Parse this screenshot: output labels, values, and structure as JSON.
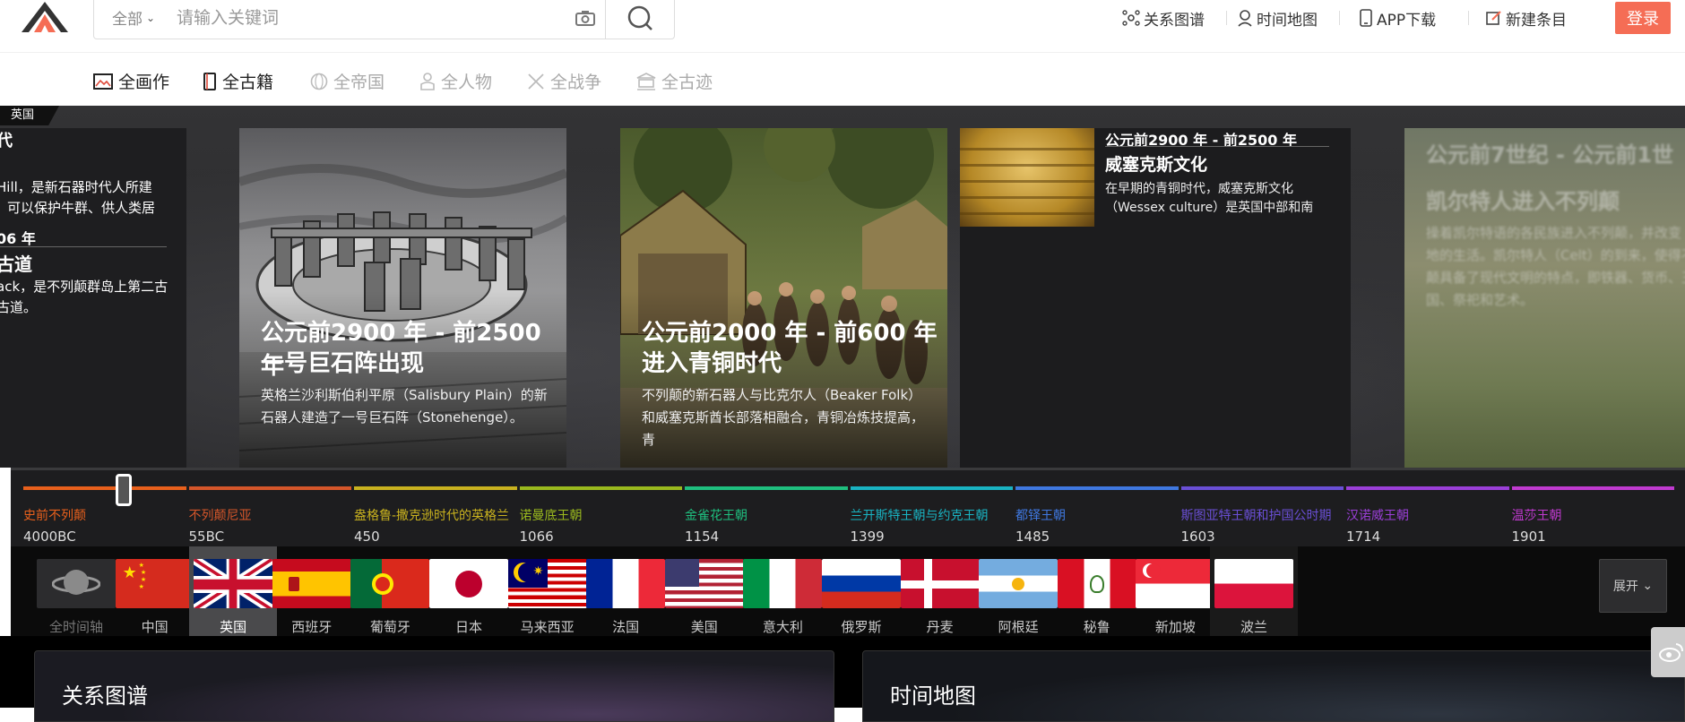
{
  "header": {
    "search": {
      "scope": "全部",
      "placeholder": "请输入关键词"
    },
    "nav": [
      {
        "label": "关系图谱",
        "icon": "relation-graph-icon"
      },
      {
        "label": "时间地图",
        "icon": "map-pin-icon"
      },
      {
        "label": "APP下载",
        "icon": "phone-icon"
      },
      {
        "label": "新建条目",
        "icon": "edit-icon"
      }
    ],
    "login": "登录",
    "colors": {
      "login_bg": "#f56d55"
    }
  },
  "categories": [
    {
      "label": "全画作",
      "icon": "painting-icon",
      "active": true
    },
    {
      "label": "全古籍",
      "icon": "book-icon",
      "active": true
    },
    {
      "label": "全帝国",
      "icon": "globe-icon",
      "active": false
    },
    {
      "label": "全人物",
      "icon": "person-icon",
      "active": false
    },
    {
      "label": "全战争",
      "icon": "swords-icon",
      "active": false
    },
    {
      "label": "全古迹",
      "icon": "temple-icon",
      "active": false
    }
  ],
  "hero": {
    "country_tag": "英国",
    "left_card": {
      "top_title": "代",
      "text1a": "Hill，是新石器时代人所建",
      "text1b": "可以保护牛群、供人类居",
      "years2": "06 年",
      "title2": "古道",
      "text2a": "ack，是不列颠群岛上第二古",
      "text2b": "古道。"
    },
    "cards": [
      {
        "years": "公元前2900 年 - 前2500 年",
        "title": "一号巨石阵出现",
        "desc": "英格兰沙利斯伯利平原（Salisbury Plain）的新石器人建造了一号巨石阵（Stonehenge）。"
      },
      {
        "years": "公元前2000 年 - 前600 年",
        "title": "进入青铜时代",
        "desc": "不列颠的新石器人与比克尔人（Beaker Folk）和威塞克斯酋长部落相融合，青铜冶炼技提高，青"
      },
      {
        "years": "公元前2900 年 - 前2500 年",
        "title": "威塞克斯文化",
        "desc": "在早期的青铜时代，威塞克斯文化（Wessex culture）是英国中部和南"
      },
      {
        "years": "公元前7世纪 - 公元前1世",
        "title": "凯尔特人进入不列颠",
        "desc_lines": [
          "操着凯尔特语的各民族进入不列颠，并改变",
          "地的生活。凯尔特人（Celt）的到来，使得不",
          "颠具备了现代文明的特点，即铁器、货币、王",
          "国、祭祀和艺术。"
        ]
      }
    ]
  },
  "timeline": {
    "eras": [
      {
        "name": "史前不列颠",
        "year": "4000BC",
        "color": "#e8601c"
      },
      {
        "name": "不列颠尼亚",
        "year": "55BC",
        "color": "#d5562a"
      },
      {
        "name": "盎格鲁-撒克逊时代的英格兰",
        "year": "450",
        "color": "#c9b21f"
      },
      {
        "name": "诺曼底王朝",
        "year": "1066",
        "color": "#9ab91e"
      },
      {
        "name": "金雀花王朝",
        "year": "1154",
        "color": "#1fbf7f"
      },
      {
        "name": "兰开斯特王朝与约克王朝",
        "year": "1399",
        "color": "#19b3c2"
      },
      {
        "name": "都铎王朝",
        "year": "1485",
        "color": "#3f78e0"
      },
      {
        "name": "斯图亚特王朝和护国公时期",
        "year": "1603",
        "color": "#6a4fd6"
      },
      {
        "name": "汉诺威王朝",
        "year": "1714",
        "color": "#9b3fd8"
      },
      {
        "name": "温莎王朝",
        "year": "1901",
        "color": "#c03ad0"
      }
    ]
  },
  "countries": [
    {
      "label": "全时间轴",
      "icon": "globe-icon"
    },
    {
      "label": "中国"
    },
    {
      "label": "英国",
      "selected": true
    },
    {
      "label": "西班牙"
    },
    {
      "label": "葡萄牙"
    },
    {
      "label": "日本"
    },
    {
      "label": "马来西亚"
    },
    {
      "label": "法国"
    },
    {
      "label": "美国"
    },
    {
      "label": "意大利"
    },
    {
      "label": "俄罗斯"
    },
    {
      "label": "丹麦"
    },
    {
      "label": "阿根廷"
    },
    {
      "label": "秘鲁"
    },
    {
      "label": "新加坡"
    },
    {
      "label": "波兰"
    }
  ],
  "expand": "展开",
  "panels": [
    {
      "title": "关系图谱"
    },
    {
      "title": "时间地图"
    }
  ]
}
